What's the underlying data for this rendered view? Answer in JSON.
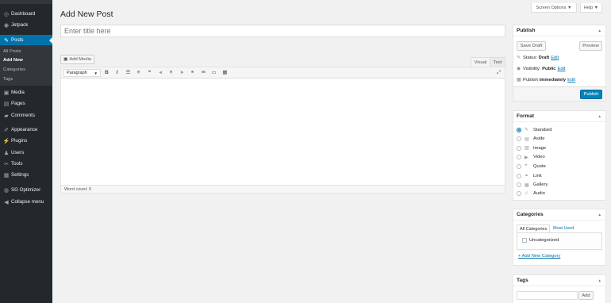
{
  "sidebar": {
    "items": [
      {
        "icon": "dashboard-icon",
        "glyph": "◎",
        "label": "Dashboard"
      },
      {
        "icon": "jetpack-icon",
        "glyph": "◉",
        "label": "Jetpack"
      },
      {
        "icon": "pushpin-icon",
        "glyph": "✎",
        "label": "Posts"
      },
      {
        "icon": "media-icon",
        "glyph": "▣",
        "label": "Media"
      },
      {
        "icon": "pages-icon",
        "glyph": "▤",
        "label": "Pages"
      },
      {
        "icon": "comments-icon",
        "glyph": "▰",
        "label": "Comments"
      },
      {
        "icon": "appearance-icon",
        "glyph": "✐",
        "label": "Appearance"
      },
      {
        "icon": "plugins-icon",
        "glyph": "⚡",
        "label": "Plugins"
      },
      {
        "icon": "users-icon",
        "glyph": "♟",
        "label": "Users"
      },
      {
        "icon": "tools-icon",
        "glyph": "✂",
        "label": "Tools"
      },
      {
        "icon": "settings-icon",
        "glyph": "▦",
        "label": "Settings"
      },
      {
        "icon": "sg-optimizer-icon",
        "glyph": "◍",
        "label": "SG Optimizer"
      },
      {
        "icon": "collapse-icon",
        "glyph": "◀",
        "label": "Collapse menu"
      }
    ],
    "submenu": [
      "All Posts",
      "Add New",
      "Categories",
      "Tags"
    ]
  },
  "header": {
    "screen_options": "Screen Options ▼",
    "help": "Help ▼",
    "title": "Add New Post"
  },
  "editor": {
    "title_placeholder": "Enter title here",
    "add_media": "Add Media",
    "tab_visual": "Visual",
    "tab_text": "Text",
    "format": "Paragraph",
    "word_count": "Word count: 0",
    "toolbar_icons": [
      "bold-icon",
      "italic-icon",
      "bullet-list-icon",
      "numbered-list-icon",
      "blockquote-icon",
      "align-left-icon",
      "align-center-icon",
      "align-right-icon",
      "link-icon",
      "unlink-icon",
      "read-more-icon",
      "toolbar-toggle-icon"
    ],
    "toolbar_glyphs": [
      "B",
      "I",
      "☰",
      "≡",
      "❝",
      "⫷",
      "≡",
      "⫸",
      "⚭",
      "⚮",
      "▭",
      "▦"
    ]
  },
  "publish": {
    "title": "Publish",
    "save_draft": "Save Draft",
    "preview": "Preview",
    "status_label": "Status:",
    "status_value": "Draft",
    "visibility_label": "Visibility:",
    "visibility_value": "Public",
    "publish_label": "Publish",
    "publish_value": "immediately",
    "edit": "Edit",
    "publish_button": "Publish"
  },
  "format_box": {
    "title": "Format",
    "options": [
      {
        "icon": "pushpin-icon",
        "glyph": "✎",
        "label": "Standard",
        "selected": true
      },
      {
        "icon": "aside-icon",
        "glyph": "▤",
        "label": "Aside",
        "selected": false
      },
      {
        "icon": "image-icon",
        "glyph": "▨",
        "label": "Image",
        "selected": false
      },
      {
        "icon": "video-icon",
        "glyph": "▶",
        "label": "Video",
        "selected": false
      },
      {
        "icon": "quote-icon",
        "glyph": "❝",
        "label": "Quote",
        "selected": false
      },
      {
        "icon": "link-icon",
        "glyph": "⚭",
        "label": "Link",
        "selected": false
      },
      {
        "icon": "gallery-icon",
        "glyph": "▦",
        "label": "Gallery",
        "selected": false
      },
      {
        "icon": "audio-icon",
        "glyph": "♫",
        "label": "Audio",
        "selected": false
      }
    ]
  },
  "categories_box": {
    "title": "Categories",
    "tab_all": "All Categories",
    "tab_used": "Most Used",
    "items": [
      "Uncategorized"
    ],
    "add_new": "+ Add New Category"
  },
  "tags_box": {
    "title": "Tags",
    "add": "Add"
  },
  "colors": {
    "accent": "#0073aa",
    "sidebar_bg": "#23282d",
    "publish_bg": "#0085ba"
  }
}
